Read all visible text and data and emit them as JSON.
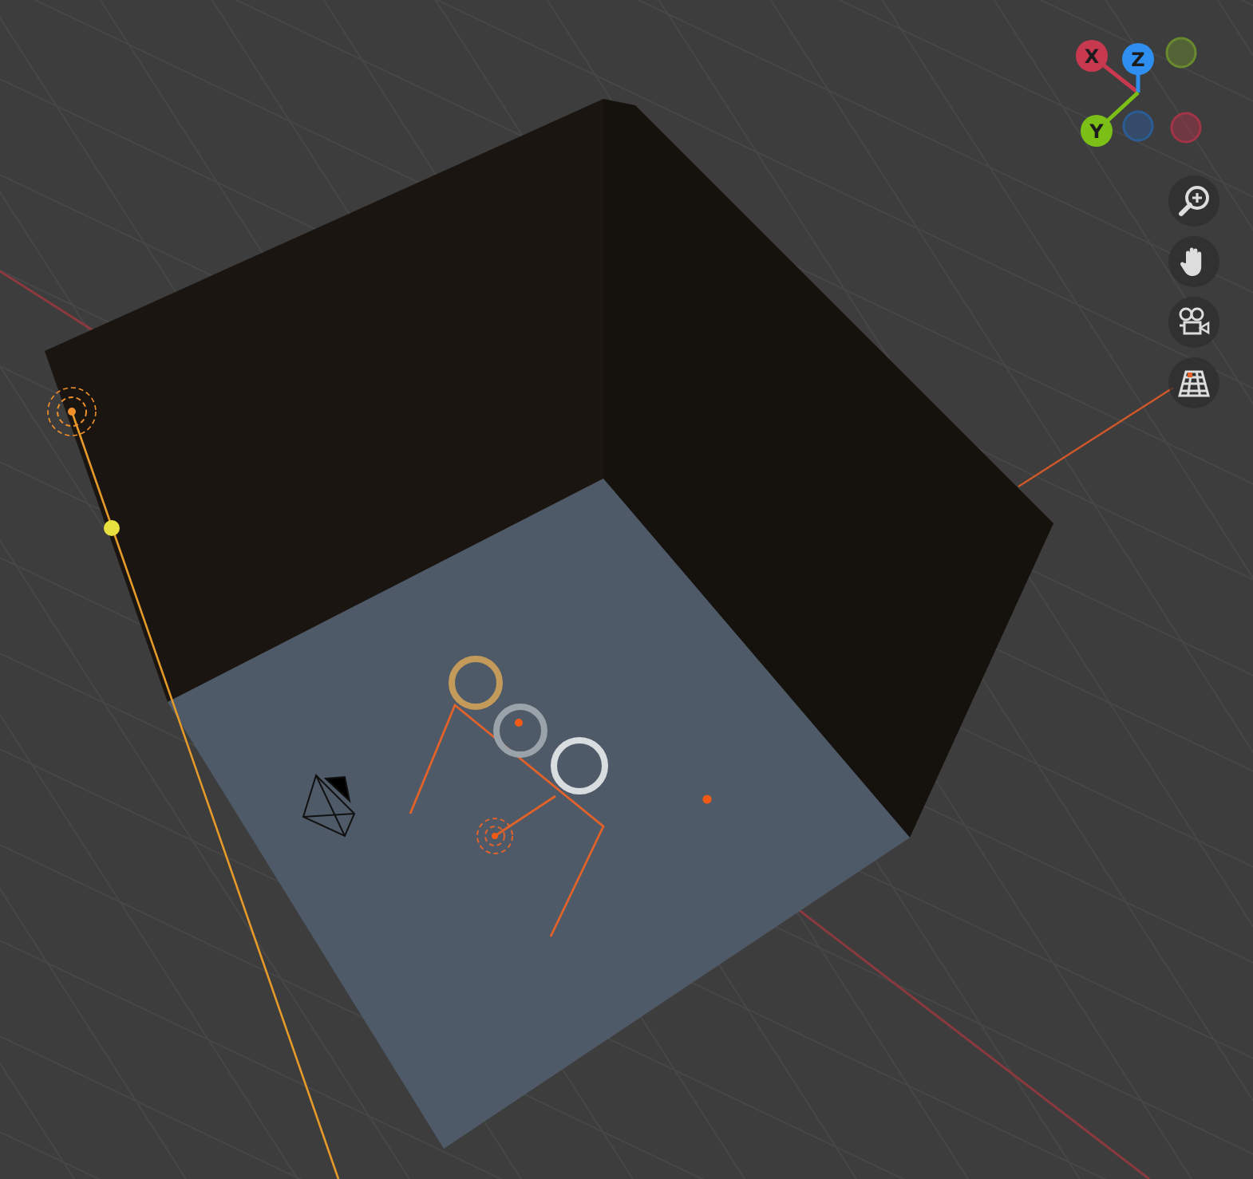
{
  "navigation_gizmo": {
    "axes": [
      {
        "kind": "positive",
        "label": "X",
        "color": "#c8384f"
      },
      {
        "kind": "positive",
        "label": "Z",
        "color": "#2f8ff0"
      },
      {
        "kind": "negative",
        "color": "#6a8a2e"
      },
      {
        "kind": "positive",
        "label": "Y",
        "color": "#7bbf17"
      },
      {
        "kind": "negative",
        "color": "#2b5c96"
      },
      {
        "kind": "negative",
        "color": "#a33447"
      }
    ]
  },
  "view_tools": [
    {
      "kind": "zoom"
    },
    {
      "kind": "pan"
    },
    {
      "kind": "camera"
    },
    {
      "kind": "perspective"
    }
  ]
}
